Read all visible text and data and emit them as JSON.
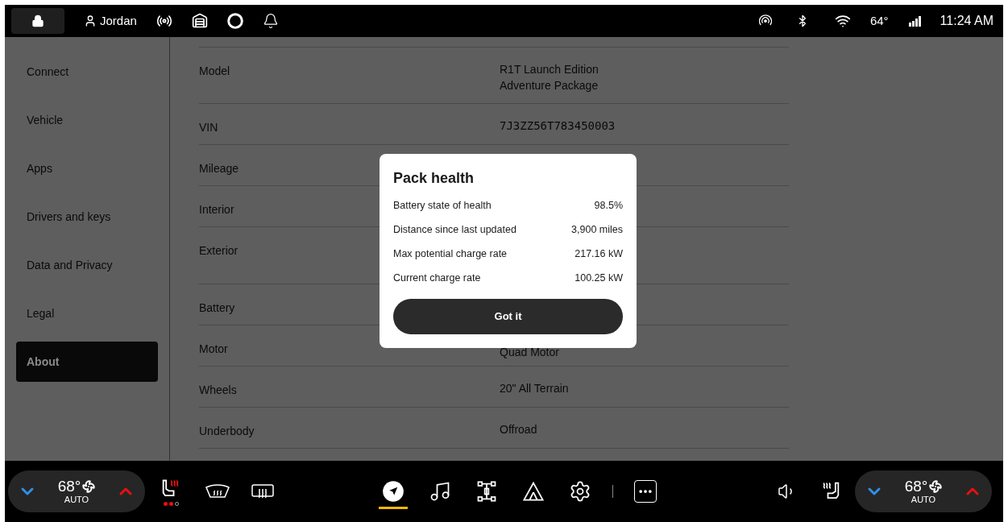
{
  "status_bar": {
    "user": "Jordan",
    "temperature": "64°",
    "time": "11:24 AM"
  },
  "sidebar": {
    "items": [
      {
        "label": "Connect",
        "selected": false
      },
      {
        "label": "Vehicle",
        "selected": false
      },
      {
        "label": "Apps",
        "selected": false
      },
      {
        "label": "Drivers and keys",
        "selected": false
      },
      {
        "label": "Data and Privacy",
        "selected": false
      },
      {
        "label": "Legal",
        "selected": false
      },
      {
        "label": "About",
        "selected": true
      }
    ]
  },
  "details": {
    "rows": [
      {
        "label": "Model",
        "kind": "text",
        "value": [
          "R1T Launch Edition",
          "Adventure Package"
        ]
      },
      {
        "label": "VIN",
        "kind": "code",
        "value": [
          "7J3ZZ56T783450003"
        ]
      },
      {
        "label": "Mileage",
        "kind": "text",
        "value": []
      },
      {
        "label": "Interior",
        "kind": "text",
        "value": []
      },
      {
        "label": "Exterior",
        "kind": "tall",
        "value": []
      },
      {
        "label": "Battery",
        "kind": "text",
        "value": []
      },
      {
        "label": "Motor",
        "kind": "text",
        "value": [
          "Quad Motor"
        ]
      },
      {
        "label": "Wheels",
        "kind": "text",
        "value": [
          "20\" All Terrain"
        ]
      },
      {
        "label": "Underbody",
        "kind": "text",
        "value": [
          "Offroad"
        ]
      }
    ]
  },
  "modal": {
    "title": "Pack health",
    "rows": [
      {
        "label": "Battery state of health",
        "value": "98.5%"
      },
      {
        "label": "Distance since last updated",
        "value": "3,900 miles"
      },
      {
        "label": "Max potential charge rate",
        "value": "217.16 kW"
      },
      {
        "label": "Current charge rate",
        "value": "100.25 kW"
      }
    ],
    "button": "Got it"
  },
  "bottom_bar": {
    "climate_left": {
      "temperature": "68°",
      "mode": "AUTO"
    },
    "seat_heat": [
      {
        "on": true
      },
      {
        "on": true
      },
      {
        "on": false
      }
    ],
    "apps": [
      {
        "kind": "navigation",
        "selected": true
      },
      {
        "kind": "music",
        "selected": false
      },
      {
        "kind": "drive",
        "selected": false
      },
      {
        "kind": "camp",
        "selected": false
      },
      {
        "kind": "settings",
        "selected": false
      },
      {
        "kind": "more",
        "selected": false
      }
    ],
    "climate_right": {
      "temperature": "68°",
      "mode": "AUTO"
    }
  }
}
